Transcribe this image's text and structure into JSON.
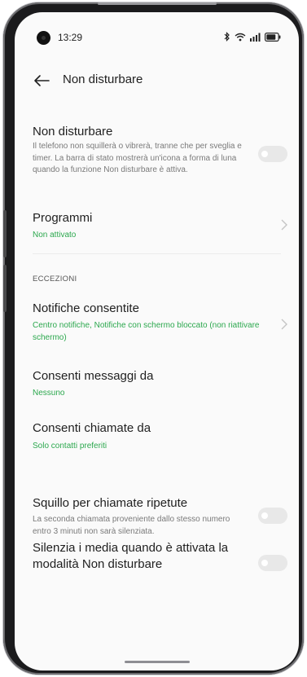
{
  "status_bar": {
    "time": "13:29",
    "icons": [
      "bluetooth-icon",
      "wifi-icon",
      "signal-icon",
      "battery-icon"
    ]
  },
  "header": {
    "title": "Non disturbare",
    "back_icon": "back-arrow-icon"
  },
  "main_toggle": {
    "title": "Non disturbare",
    "description": "Il telefono non squillerà o vibrerà, tranne che per sveglia e timer. La barra di stato mostrerà un'icona a forma di luna quando la funzione Non disturbare è attiva.",
    "enabled": false
  },
  "schedules": {
    "title": "Programmi",
    "status": "Non attivato"
  },
  "exceptions": {
    "section_label": "ECCEZIONI",
    "notifications": {
      "title": "Notifiche consentite",
      "value": "Centro notifiche, Notifiche con schermo bloccato (non riattivare schermo)"
    },
    "messages": {
      "title": "Consenti messaggi da",
      "value": "Nessuno"
    },
    "calls": {
      "title": "Consenti chiamate da",
      "value": "Solo contatti preferiti"
    }
  },
  "repeat_calls": {
    "title": "Squillo per chiamate ripetute",
    "description": "La seconda chiamata proveniente dallo stesso numero entro 3 minuti non sarà silenziata.",
    "enabled": false
  },
  "mute_media": {
    "title": "Silenzia i media quando è attivata la modalità Non disturbare",
    "enabled": false
  },
  "colors": {
    "accent_green": "#2ca84e",
    "toggle_off": "#e8e8e8",
    "background": "#fafafa"
  }
}
